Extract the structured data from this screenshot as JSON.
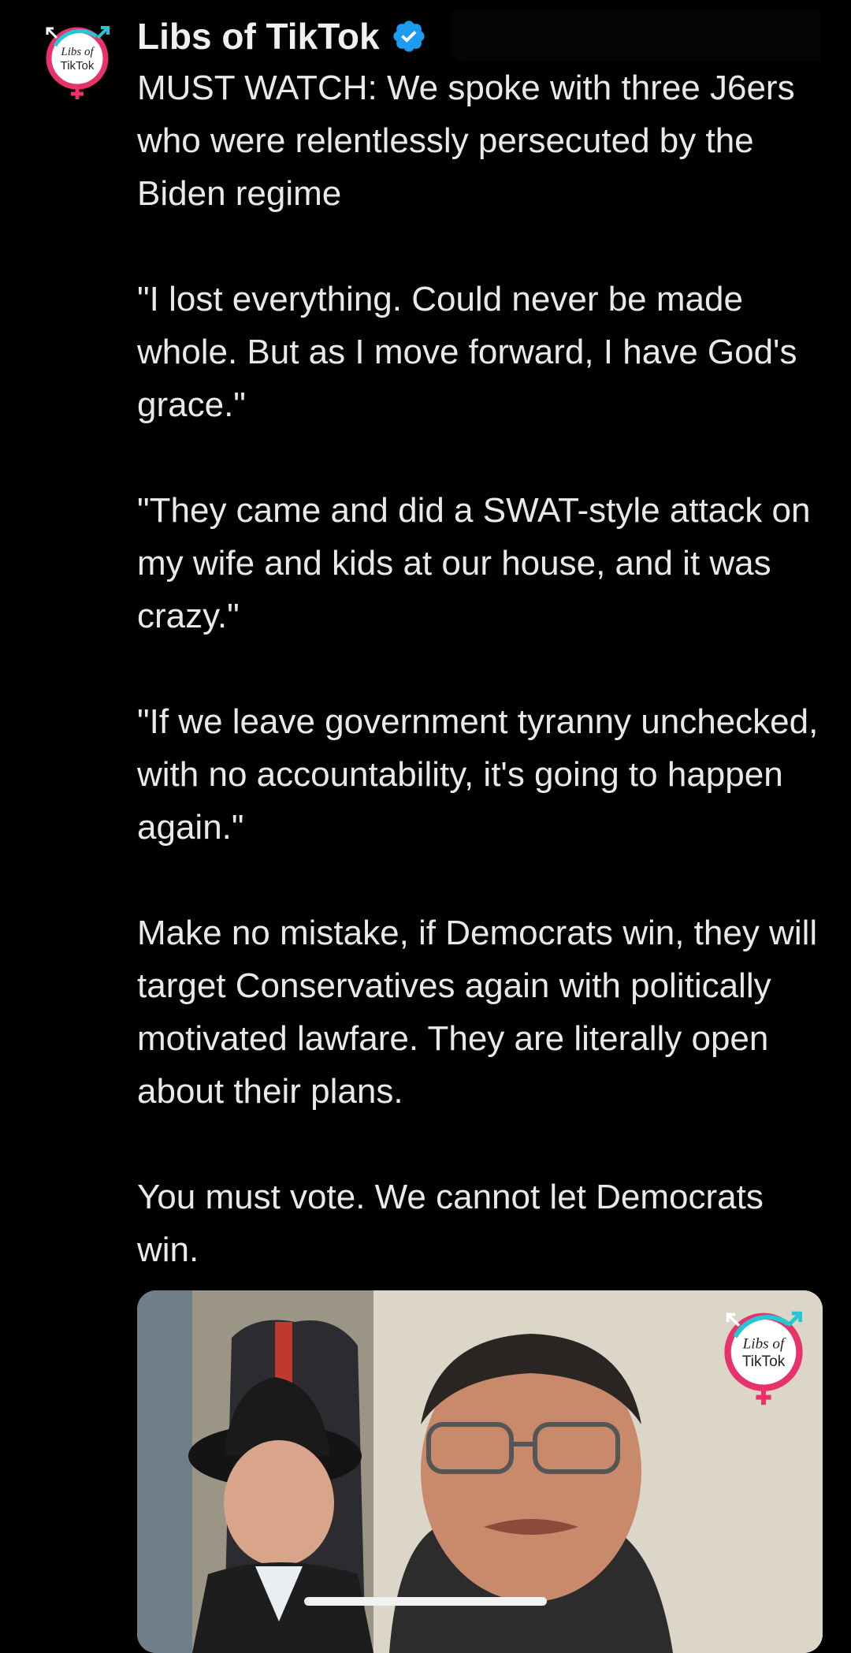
{
  "post": {
    "author": {
      "display_name": "Libs of TikTok",
      "verified": true,
      "avatar_text": [
        "Libs of",
        "TikTok"
      ]
    },
    "paragraphs": [
      "MUST WATCH: We spoke with three J6ers who were relentlessly persecuted by the Biden regime",
      "\"I lost everything. Could never be made whole. But as I move forward, I have God's grace.\"",
      "\"They came and did a SWAT-style attack on my wife and kids at our house, and it was crazy.\"",
      "\"If we leave government tyranny unchecked, with no accountability, it's going to happen again.\"",
      "Make no mistake, if Democrats win, they will target Conservatives again with politically motivated lawfare. They are literally open about their plans.",
      "You must vote. We cannot let Democrats win."
    ],
    "media": {
      "type": "video",
      "watermark_text": [
        "Libs of",
        "TikTok"
      ]
    }
  },
  "colors": {
    "background": "#000000",
    "text": "#e7e9ea",
    "verified_badge": "#1d9bf0",
    "logo_pink": "#e8336a",
    "logo_cyan": "#25c7d4"
  },
  "icons": {
    "verified": "verified-badge-icon",
    "avatar": "libs-of-tiktok-logo"
  }
}
